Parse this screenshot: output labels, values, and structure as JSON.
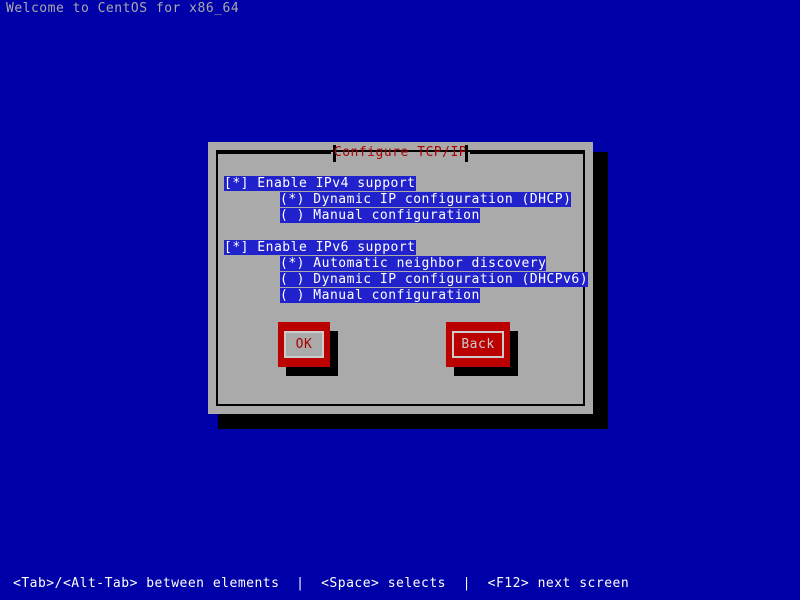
{
  "screen": {
    "background_color": "#0000a8",
    "text_color": "#aaaaaa",
    "welcome_text": "Welcome to CentOS for x86_64",
    "help_text": "<Tab>/<Alt-Tab> between elements  |  <Space> selects  |  <F12> next screen"
  },
  "dialog": {
    "title": "Configure TCP/IP",
    "title_color": "#aa0000",
    "background_color": "#aaaaaa",
    "highlight_color": "#2222cc",
    "ipv4": {
      "checkbox": "[*] Enable IPv4 support",
      "options": [
        "(*) Dynamic IP configuration (DHCP)",
        "( ) Manual configuration"
      ]
    },
    "ipv6": {
      "checkbox": "[*] Enable IPv6 support",
      "options": [
        "(*) Automatic neighbor discovery",
        "( ) Dynamic IP configuration (DHCPv6)",
        "( ) Manual configuration"
      ]
    },
    "buttons": {
      "ok": "OK",
      "back": "Back",
      "accent_color": "#bb0000"
    }
  }
}
